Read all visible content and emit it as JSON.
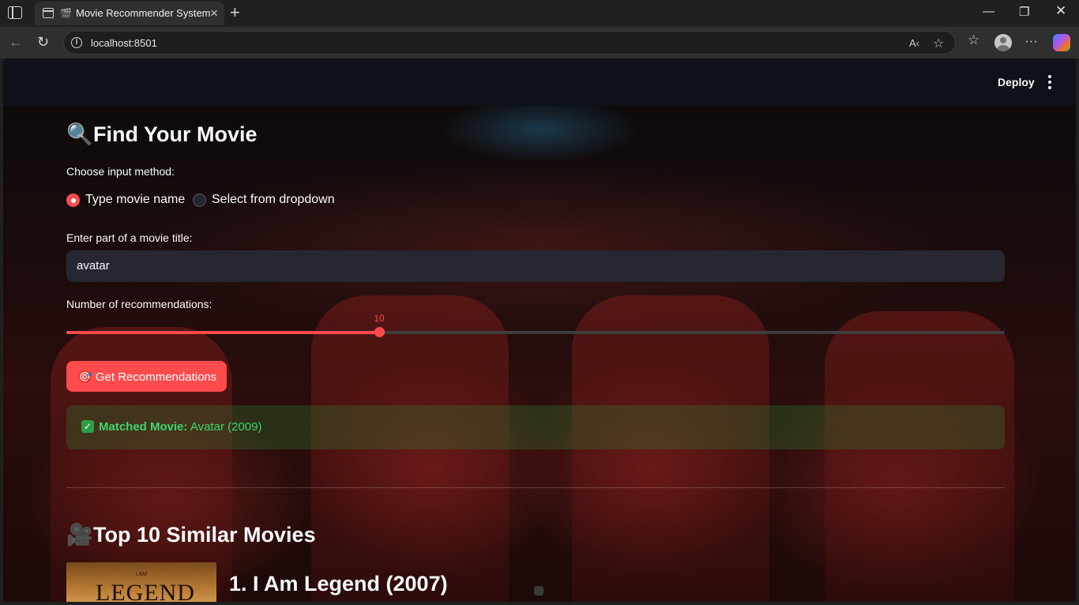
{
  "browser": {
    "tab_title": "Movie Recommender System",
    "url": "localhost:8501"
  },
  "app": {
    "deploy_label": "Deploy",
    "find_title": "Find Your Movie",
    "find_emoji": "🔍",
    "input_method_label": "Choose input method:",
    "radio_options": [
      "Type movie name",
      "Select from dropdown"
    ],
    "radio_selected": "Type movie name",
    "title_input_label": "Enter part of a movie title:",
    "title_input_value": "avatar",
    "recs_label": "Number of recommendations:",
    "recs_value": 10,
    "recs_fraction": 0.333,
    "button_emoji": "🎯",
    "button_label": "Get Recommendations",
    "match_label": "Matched Movie:",
    "match_value": "Avatar (2009)",
    "similar_emoji": "🎥",
    "similar_title": "Top 10 Similar Movies",
    "first_result": {
      "title": "1. I Am Legend (2007)",
      "poster_small": "I AM",
      "poster_big": "LEGEND"
    }
  },
  "colors": {
    "accent": "#ff4b4b",
    "success_text": "#3dd56d",
    "header_bg": "#0e1117"
  }
}
